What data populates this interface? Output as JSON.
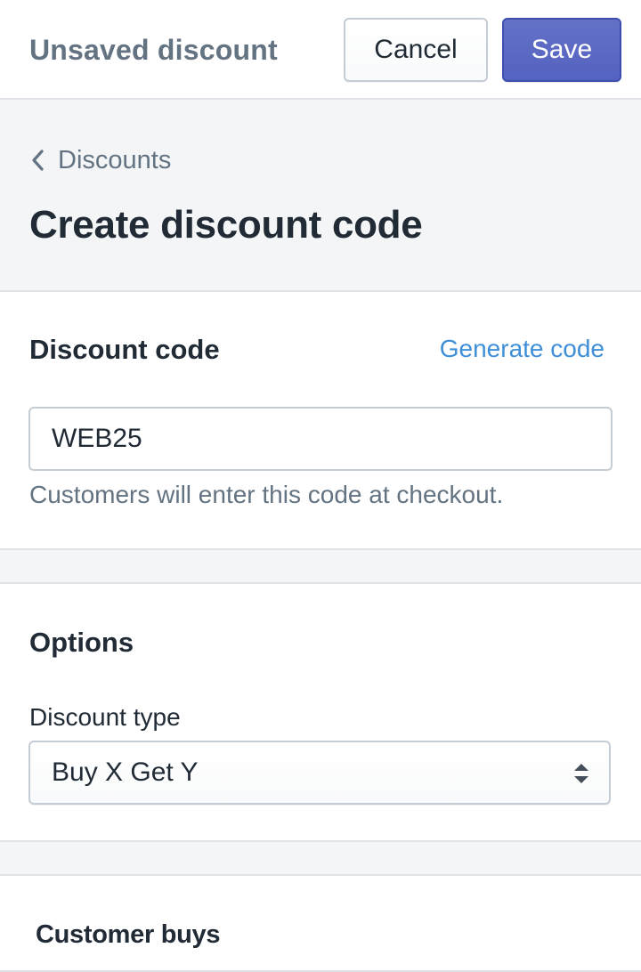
{
  "topbar": {
    "title": "Unsaved discount",
    "cancel_label": "Cancel",
    "save_label": "Save"
  },
  "header": {
    "breadcrumb": "Discounts",
    "title": "Create discount code"
  },
  "discount_code_card": {
    "heading": "Discount code",
    "generate_link": "Generate code",
    "code_value": "WEB25",
    "help_text": "Customers will enter this code at checkout."
  },
  "options_card": {
    "heading": "Options",
    "discount_type_label": "Discount type",
    "discount_type_value": "Buy X Get Y"
  },
  "customer_buys_card": {
    "heading": "Customer buys"
  },
  "colors": {
    "primary": "#5c6ac4",
    "link": "#3e8fd8",
    "subdued_text": "#637381",
    "background": "#f4f5f7"
  },
  "icons": {
    "breadcrumb": "chevron-left-icon",
    "select": "select-arrows-icon"
  }
}
